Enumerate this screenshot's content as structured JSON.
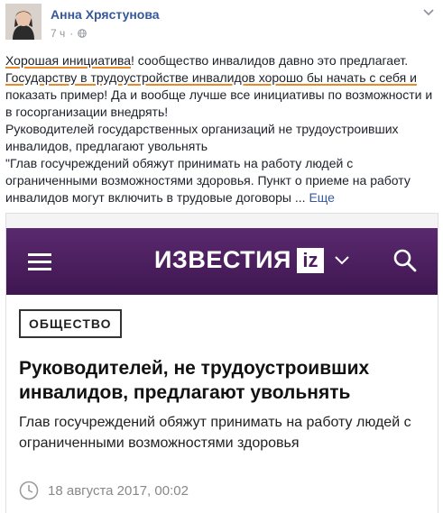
{
  "post": {
    "author": "Анна Хрястунова",
    "time": "7 ч",
    "text": {
      "p1_highlight_1": "Хорошая инициатива",
      "p1_rest": "! сообщество инвалидов давно это предлагает.",
      "p2_highlight": "Государству в трудоустройстве инвалидов хорошо бы начать с себя и",
      "p2_rest": " показать пример! Да и вообще лучше все инициативы по возможности и в госорганизации внедрять!",
      "p3": "Руководителей государственных организаций не трудоустроивших инвалидов, предлагают увольнять",
      "p4": "\"Глав госучреждений обяжут принимать на работу людей с ограниченными возможностями здоровья. Пункт о приеме на работу инвалидов могут включить в трудовые договоры ...",
      "more_label": "Еще"
    }
  },
  "preview": {
    "site_logo_text": "ИЗВЕСТИЯ",
    "site_logo_badge": "iz",
    "tag": "ОБЩЕСТВО",
    "headline": "Руководителей, не трудоустроивших инвалидов, предлагают увольнять",
    "lead": "Глав госучреждений обяжут принимать на работу людей с ограниченными возможностями здоровья",
    "date": "18 августа 2017, 00:02"
  },
  "colors": {
    "link": "#365899",
    "highlight_underline": "#e8892a",
    "izvestia_bar": "#4a1d5f"
  },
  "icons": [
    "globe-icon",
    "chevron-down-icon",
    "menu-icon",
    "search-icon",
    "clock-icon"
  ]
}
